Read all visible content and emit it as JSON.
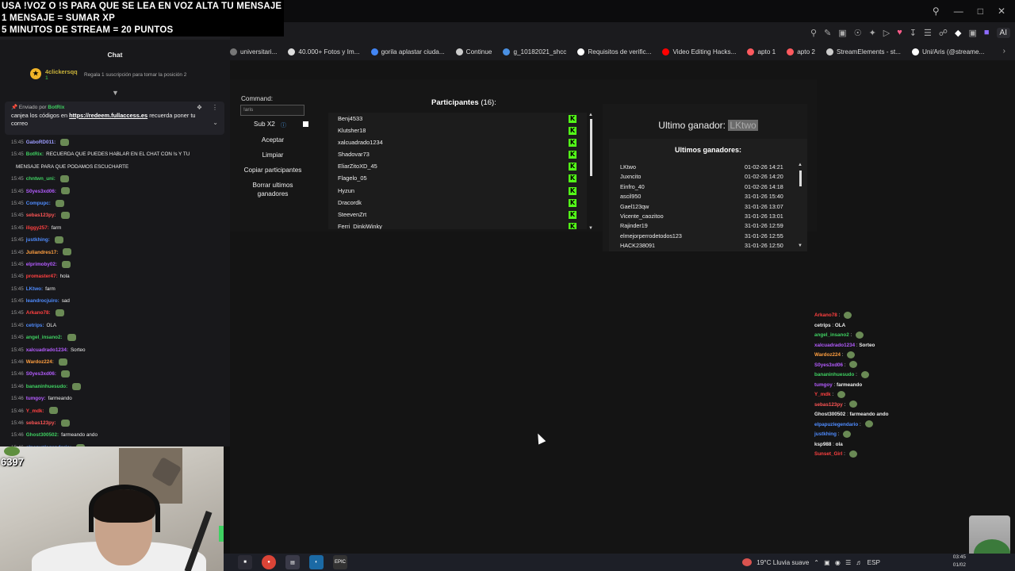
{
  "overlay_banner": {
    "line1": "USA !VOZ O !S PARA QUE SE LEA EN VOZ ALTA TU MENSAJE",
    "line2": "1 MENSAJE = SUMAR XP",
    "line3": "5 MINUTOS DE STREAM = 20 PUNTOS"
  },
  "browser": {
    "toolbar_ai_label": "AI",
    "bookmarks": [
      {
        "label": "universitari...",
        "icon": "folder-icon",
        "color": "#777777"
      },
      {
        "label": "40.000+ Fotos y Im...",
        "icon": "camera-icon",
        "color": "#dddddd"
      },
      {
        "label": "gorila aplastar ciuda...",
        "icon": "google-icon",
        "color": "#4285f4"
      },
      {
        "label": "Continue",
        "icon": "doc-icon",
        "color": "#cccccc"
      },
      {
        "label": "g_10182021_shcc",
        "icon": "meet-icon",
        "color": "#4a90e2"
      },
      {
        "label": "Requisitos de verific...",
        "icon": "x-icon",
        "color": "#ffffff"
      },
      {
        "label": "Video Editing Hacks...",
        "icon": "youtube-icon",
        "color": "#ff0000"
      },
      {
        "label": "apto 1",
        "icon": "airbnb-icon",
        "color": "#ff5a5f"
      },
      {
        "label": "apto 2",
        "icon": "airbnb-icon",
        "color": "#ff5a5f"
      },
      {
        "label": "StreamElements - st...",
        "icon": "streamelements-icon",
        "color": "#cccccc"
      },
      {
        "label": "Uni/Aris (@streame...",
        "icon": "tiktok-icon",
        "color": "#ffffff"
      }
    ]
  },
  "chat": {
    "header": "Chat",
    "hype": {
      "name": "4clickersqq",
      "count": "1",
      "message": "Regala 1 suscripción para tomar la posición 2"
    },
    "pinned": {
      "by_prefix": "Enviado por",
      "by_user": "BotRix",
      "text_before": "canjea los códigos en ",
      "link": "https://redeem.fullaccess.es",
      "text_after": " recuerda poner tu correo"
    },
    "messages": [
      {
        "time": "15:45",
        "user": "GaboRD011:",
        "color": "#9c9cff",
        "text": "",
        "emote": true
      },
      {
        "time": "15:45",
        "user": "BotRix:",
        "color": "#3fd061",
        "text": "RECUERDA QUE PUEDES HABLAR EN EL CHAT CON !s Y TU",
        "emote": false
      },
      {
        "time": "",
        "user": "",
        "color": "#eeeeee",
        "text": "MENSAJE PARA QUE PODAMOS ESCUCHARTE",
        "emote": false
      },
      {
        "time": "15:45",
        "user": "chntwn_uni:",
        "color": "#3fd061",
        "text": "",
        "emote": true
      },
      {
        "time": "15:45",
        "user": "S0yes3xd06:",
        "color": "#b45cff",
        "text": "",
        "emote": true
      },
      {
        "time": "15:45",
        "user": "Compupc:",
        "color": "#4f8cff",
        "text": "",
        "emote": true
      },
      {
        "time": "15:45",
        "user": "sebas123py:",
        "color": "#ff5555",
        "text": "",
        "emote": true
      },
      {
        "time": "15:45",
        "user": "iliggy257:",
        "color": "#ff4040",
        "text": "farm",
        "emote": false
      },
      {
        "time": "15:45",
        "user": "justkhing:",
        "color": "#4f8cff",
        "text": "",
        "emote": true
      },
      {
        "time": "15:45",
        "user": "Juliandres17:",
        "color": "#ff9f40",
        "text": "",
        "emote": true
      },
      {
        "time": "15:45",
        "user": "elprimoby02:",
        "color": "#b45cff",
        "text": "",
        "emote": true
      },
      {
        "time": "15:45",
        "user": "promaster47:",
        "color": "#ff4040",
        "text": "hola",
        "emote": false
      },
      {
        "time": "15:45",
        "user": "LKtwo:",
        "color": "#4f8cff",
        "text": "farm",
        "emote": false
      },
      {
        "time": "15:45",
        "user": "leandrocjuiro:",
        "color": "#4f8cff",
        "text": "sad",
        "emote": false
      },
      {
        "time": "15:45",
        "user": "Arkano78:",
        "color": "#ff4040",
        "text": "",
        "emote": true
      },
      {
        "time": "15:45",
        "user": "cetrips:",
        "color": "#4f8cff",
        "text": "OLA",
        "emote": false
      },
      {
        "time": "15:45",
        "user": "angel_insano2:",
        "color": "#3fd061",
        "text": "",
        "emote": true
      },
      {
        "time": "15:45",
        "user": "xalcuadrado1234:",
        "color": "#b45cff",
        "text": "Sorteo",
        "emote": false
      },
      {
        "time": "15:46",
        "user": "Wardoz224:",
        "color": "#ff9f40",
        "text": "",
        "emote": true
      },
      {
        "time": "15:46",
        "user": "S0yes3xd06:",
        "color": "#b45cff",
        "text": "",
        "emote": true
      },
      {
        "time": "15:46",
        "user": "bananinhuesudo:",
        "color": "#3fd061",
        "text": "",
        "emote": true
      },
      {
        "time": "15:46",
        "user": "tumgoy:",
        "color": "#b45cff",
        "text": "farmeando",
        "emote": false
      },
      {
        "time": "15:46",
        "user": "Y_mdk:",
        "color": "#ff4040",
        "text": "",
        "emote": true
      },
      {
        "time": "15:46",
        "user": "sebas123py:",
        "color": "#ff5555",
        "text": "",
        "emote": true
      },
      {
        "time": "15:46",
        "user": "Ghost300502:",
        "color": "#3fd061",
        "text": "farmeando ando",
        "emote": false
      },
      {
        "time": "15:46",
        "user": "elpapuzlegendario:",
        "color": "#4f8cff",
        "text": "",
        "emote": true
      }
    ]
  },
  "webcam": {
    "counter": "6397"
  },
  "giveaway": {
    "command_label": "Command:",
    "command_value": "!aris",
    "sub_label": "Sub X2",
    "accept_label": "Aceptar",
    "clear_label": "Limpiar",
    "copy_label": "Copiar participantes",
    "delete_label": "Borrar ultimos ganadores",
    "participants_title": "Participantes",
    "participants_count": "(16):",
    "participants": [
      "Benj4533",
      "Klutsher18",
      "xalcuadrado1234",
      "Shadovar73",
      "EliarZitoXD_45",
      "Flagelo_05",
      "Hyzun",
      "Dracordk",
      "SteevenZrt",
      "Ferri_DinkiWinky"
    ],
    "last_winner_label": "Ultimo ganador:",
    "last_winner_name": "LKtwo",
    "winners_title": "Ultimos ganadores:",
    "winners": [
      {
        "name": "LKtwo",
        "date": "01-02-26 14:21"
      },
      {
        "name": "Juxncito",
        "date": "01-02-26 14:20"
      },
      {
        "name": "Einfro_40",
        "date": "01-02-26 14:18"
      },
      {
        "name": "ascil950",
        "date": "31-01-26 15:40"
      },
      {
        "name": "Gael123qw",
        "date": "31-01-26 13:07"
      },
      {
        "name": "Vicente_caozitoo",
        "date": "31-01-26 13:01"
      },
      {
        "name": "Rajinder19",
        "date": "31-01-26 12:59"
      },
      {
        "name": "elmejorperrodetodos123",
        "date": "31-01-26 12:55"
      },
      {
        "name": "HACK238091",
        "date": "31-01-26 12:50"
      }
    ]
  },
  "right_chat": [
    {
      "user": "Arkano78",
      "color": "#ff4040",
      "text": "",
      "emote": true
    },
    {
      "user": "cetrips",
      "color": "#eeeeee",
      "text": "OLA",
      "emote": false
    },
    {
      "user": "angel_insano2",
      "color": "#3fd061",
      "text": "",
      "emote": true
    },
    {
      "user": "xalcuadrado1234",
      "color": "#b45cff",
      "text": "Sorteo",
      "emote": false
    },
    {
      "user": "Wardoz224",
      "color": "#ff9f40",
      "text": "",
      "emote": true
    },
    {
      "user": "S0yes3xd06",
      "color": "#b45cff",
      "text": "",
      "emote": true
    },
    {
      "user": "bananinhuesudo",
      "color": "#3fd061",
      "text": "",
      "emote": true
    },
    {
      "user": "tumgoy",
      "color": "#b45cff",
      "text": "farmeando",
      "emote": false
    },
    {
      "user": "Y_mdk",
      "color": "#ff4040",
      "text": "",
      "emote": true
    },
    {
      "user": "sebas123py",
      "color": "#ff5555",
      "text": "",
      "emote": true
    },
    {
      "user": "Ghost300502",
      "color": "#eeeeee",
      "text": "farmeando ando",
      "emote": false
    },
    {
      "user": "elpapuzlegendario",
      "color": "#4f8cff",
      "text": "",
      "emote": true
    },
    {
      "user": "justkhing",
      "color": "#4f8cff",
      "text": "",
      "emote": true
    },
    {
      "user": "ksp988",
      "color": "#eeeeee",
      "text": "ola",
      "emote": false
    },
    {
      "user": "Sunset_Girl",
      "color": "#ff4040",
      "text": "",
      "emote": true
    }
  ],
  "taskbar": {
    "weather": "19°C Lluvia suave",
    "lang": "ESP",
    "time": "03:45",
    "date": "01/02"
  }
}
